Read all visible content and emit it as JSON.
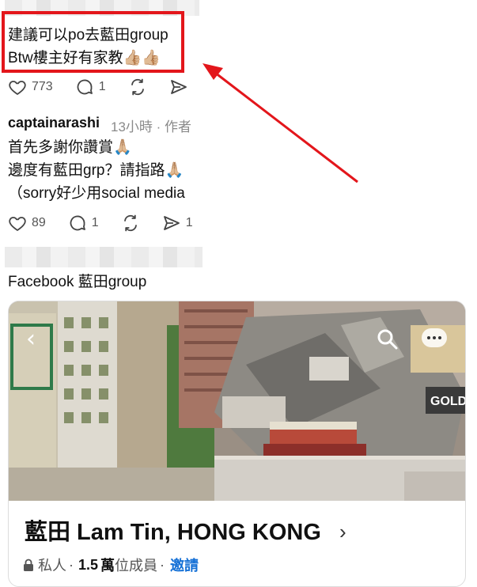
{
  "reply1": {
    "line1": "建議可以po去藍田group",
    "line2": "Btw樓主好有家教👍🏼👍🏼",
    "likes": "773",
    "replies": "1"
  },
  "reply2": {
    "username": "captainarashi",
    "meta": "13小時 · 作者",
    "line1": "首先多謝你讚賞🙏🏼",
    "line2": "邊度有藍田grp？請指路🙏🏼",
    "line3": "（sorry好少用social media",
    "likes": "89",
    "replies": "1",
    "shares": "1"
  },
  "reply3": {
    "line1": "Facebook 藍田group"
  },
  "group_card": {
    "name": "藍田 Lam Tin, HONG KONG",
    "privacy": "私人",
    "members_count": "1.5",
    "members_unit": "萬",
    "members_label": "位成員",
    "invite": "邀請",
    "sign_text": "GOLD"
  },
  "colors": {
    "highlight": "#e3161b",
    "invite": "#1470d6"
  }
}
